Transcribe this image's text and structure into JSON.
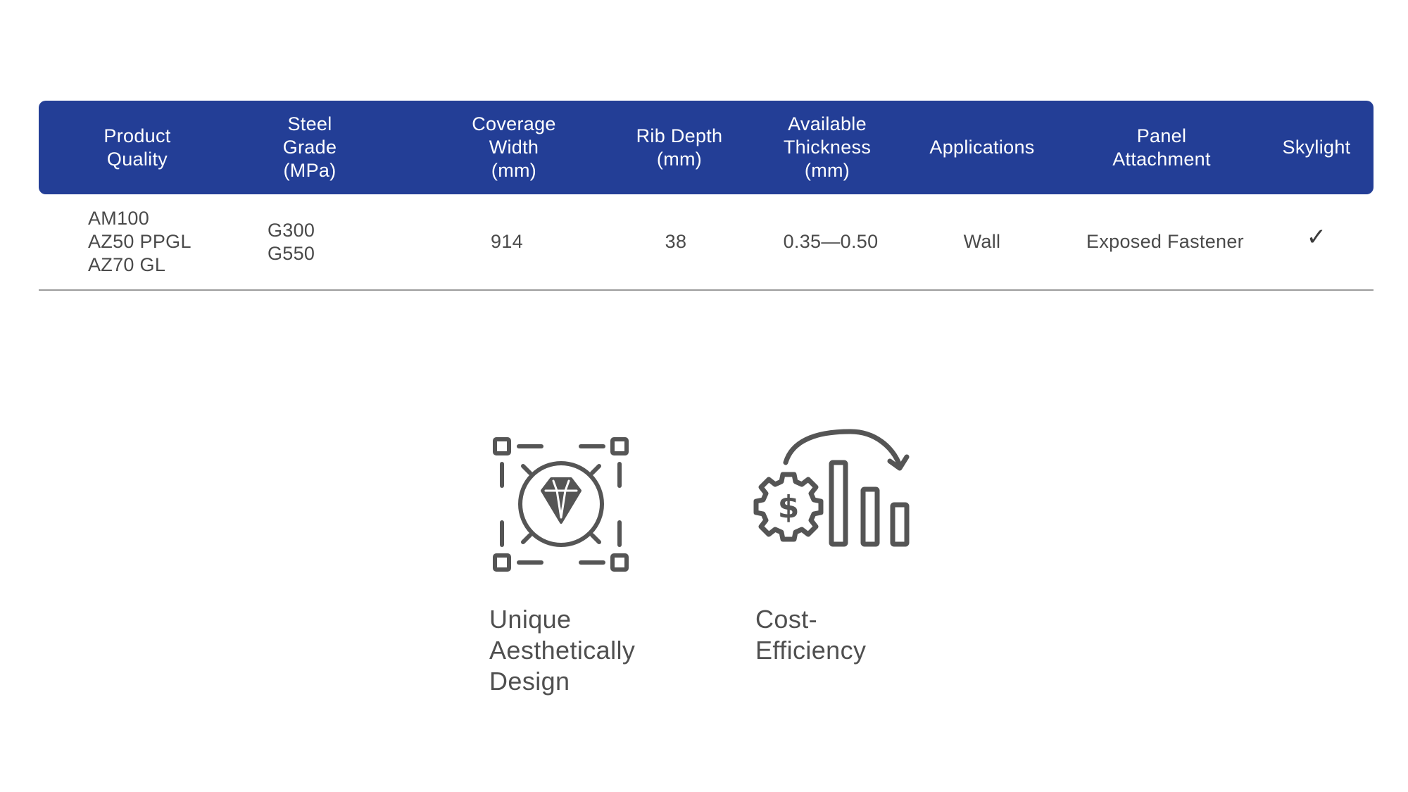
{
  "table": {
    "headers": [
      "Product\nQuality",
      "Steel\nGrade\n(MPa)",
      "Coverage\nWidth\n(mm)",
      "Rib Depth\n(mm)",
      "Available\nThickness\n(mm)",
      "Applications",
      "Panel\nAttachment",
      "Skylight"
    ],
    "rows": [
      [
        "AM100\nAZ50 PPGL\nAZ70 GL",
        "G300\nG550",
        "914",
        "38",
        "0.35—0.50",
        "Wall",
        "Exposed Fastener",
        "✓"
      ]
    ]
  },
  "features": [
    {
      "icon": "diamond-design-icon",
      "label": "Unique\nAesthetically\nDesign"
    },
    {
      "icon": "cost-efficiency-icon",
      "label": "Cost-Efficiency"
    }
  ],
  "colors": {
    "header_bg": "#233e96",
    "header_text": "#ffffff",
    "body_text": "#4a4a4a",
    "icon": "#555555",
    "row_divider": "#9c9c9c"
  }
}
